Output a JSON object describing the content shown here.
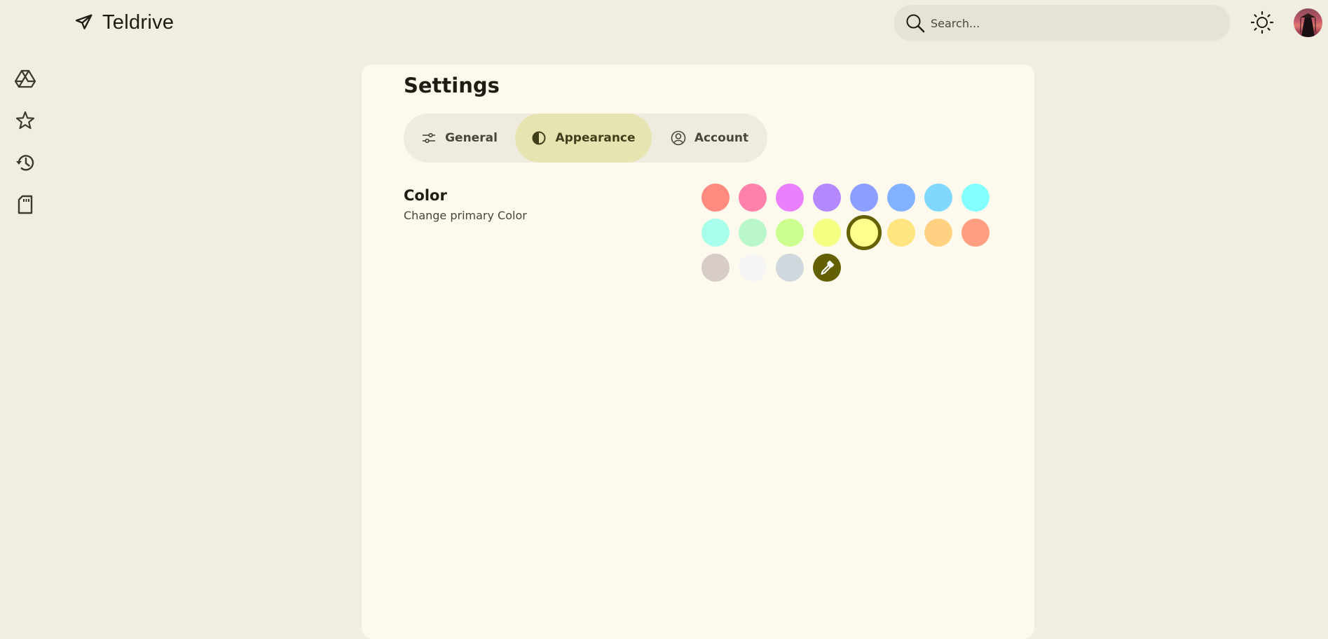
{
  "header": {
    "app_title": "Teldrive",
    "logo_icon": "paper-plane-icon",
    "search": {
      "placeholder": "Search...",
      "value": ""
    },
    "theme_toggle_icon": "sun-icon",
    "avatar_alt": "user-avatar"
  },
  "sidebar": {
    "items": [
      {
        "name": "my-drive",
        "icon": "google-drive-icon"
      },
      {
        "name": "starred",
        "icon": "star-icon"
      },
      {
        "name": "recent",
        "icon": "history-icon"
      },
      {
        "name": "storage",
        "icon": "sd-card-icon"
      }
    ]
  },
  "settings": {
    "title": "Settings",
    "tabs": [
      {
        "label": "General",
        "icon": "sliders-icon",
        "active": false
      },
      {
        "label": "Appearance",
        "icon": "contrast-icon",
        "active": true
      },
      {
        "label": "Account",
        "icon": "account-circle-icon",
        "active": false
      }
    ],
    "color_section": {
      "title": "Color",
      "subtitle": "Change primary Color",
      "selected_index": 12,
      "swatches": [
        "#ff8a80",
        "#ff80ab",
        "#ea80fc",
        "#b388ff",
        "#8c9eff",
        "#82b1ff",
        "#80d8ff",
        "#84ffff",
        "#a7ffeb",
        "#b9f6ca",
        "#ccff90",
        "#f4ff81",
        "#ffff8d",
        "#ffe57f",
        "#ffd180",
        "#ff9e80",
        "#d7ccc8",
        "#f5f5f5",
        "#cfd8dc"
      ],
      "custom_picker_icon": "eyedropper-icon",
      "custom_picker_color": "#626000"
    }
  },
  "colors": {
    "background": "#f1ede1",
    "card": "#fdf9ec",
    "tab_bar": "#efebdf",
    "tab_active": "#e6e4b0",
    "accent_dark": "#646200"
  }
}
